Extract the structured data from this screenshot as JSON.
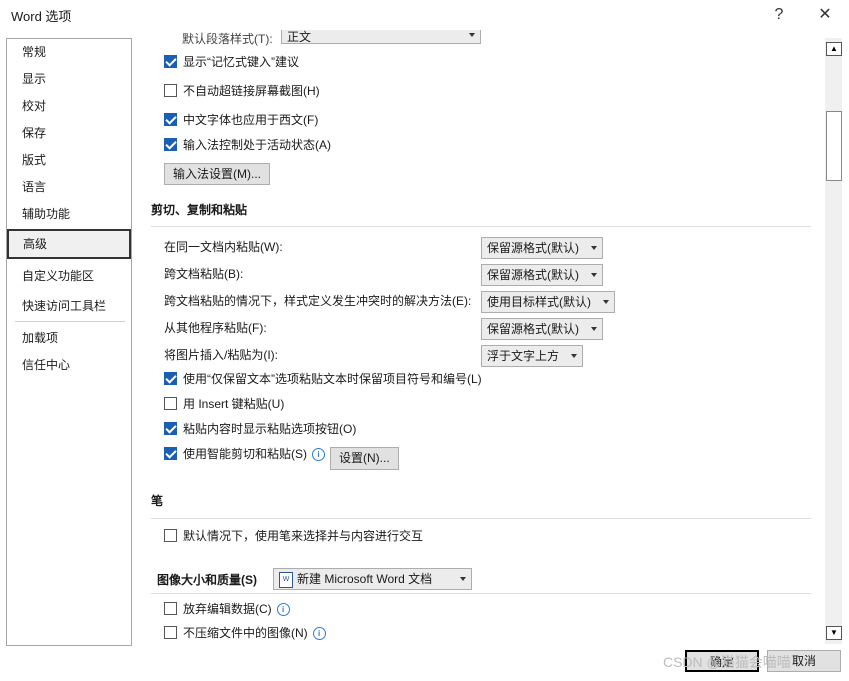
{
  "window": {
    "title": "Word 选项",
    "help": "?",
    "close": "✕"
  },
  "sidebar": {
    "items": [
      {
        "label": "常规"
      },
      {
        "label": "显示"
      },
      {
        "label": "校对"
      },
      {
        "label": "保存"
      },
      {
        "label": "版式"
      },
      {
        "label": "语言"
      },
      {
        "label": "辅助功能"
      },
      {
        "label": "高级"
      },
      {
        "label": "自定义功能区"
      },
      {
        "label": "快速访问工具栏"
      },
      {
        "label": "加载项"
      },
      {
        "label": "信任中心"
      }
    ],
    "active": "高级"
  },
  "top_partial": {
    "label": "默认段落样式(T):",
    "value": "正文"
  },
  "input_options": {
    "show_autocomplete": {
      "label": "显示“记忆式键入”建议",
      "checked": true
    },
    "no_auto_hyperlink_screenshot": {
      "label": "不自动超链接屏幕截图(H)",
      "checked": false
    },
    "chinese_font_for_western": {
      "label": "中文字体也应用于西文(F)",
      "checked": true
    },
    "ime_control_active": {
      "label": "输入法控制处于活动状态(A)",
      "checked": true
    },
    "ime_settings_button": "输入法设置(M)..."
  },
  "cut_copy_paste": {
    "heading": "剪切、复制和粘贴",
    "rows": [
      {
        "label": "在同一文档内粘贴(W):",
        "value": "保留源格式(默认)"
      },
      {
        "label": "跨文档粘贴(B):",
        "value": "保留源格式(默认)"
      },
      {
        "label": "跨文档粘贴的情况下，样式定义发生冲突时的解决方法(E):",
        "value": "使用目标样式(默认)"
      },
      {
        "label": "从其他程序粘贴(F):",
        "value": "保留源格式(默认)"
      },
      {
        "label": "将图片插入/粘贴为(I):",
        "value": "浮于文字上方"
      }
    ],
    "keep_bullets": {
      "label": "使用“仅保留文本”选项粘贴文本时保留项目符号和编号(L)",
      "checked": true
    },
    "insert_key_paste": {
      "label": "用 Insert 键粘贴(U)",
      "checked": false
    },
    "show_paste_options": {
      "label": "粘贴内容时显示粘贴选项按钮(O)",
      "checked": true
    },
    "smart_cut_paste": {
      "label": "使用智能剪切和粘贴(S)",
      "checked": true
    },
    "settings_button": "设置(N)..."
  },
  "pen": {
    "heading": "笔",
    "use_pen_select": {
      "label": "默认情况下，使用笔来选择并与内容进行交互",
      "checked": false
    }
  },
  "image_size_quality": {
    "heading": "图像大小和质量(S)",
    "document": "新建 Microsoft Word 文档",
    "discard_edit_data": {
      "label": "放弃编辑数据(C)",
      "checked": false
    },
    "no_compress": {
      "label": "不压缩文件中的图像(N)",
      "checked": false
    }
  },
  "footer": {
    "ok": "确定",
    "cancel": "取消"
  },
  "watermark": "CSDN @猫猫会喵喵",
  "icons": {
    "info": "info-icon",
    "doc": "word-doc-icon"
  }
}
